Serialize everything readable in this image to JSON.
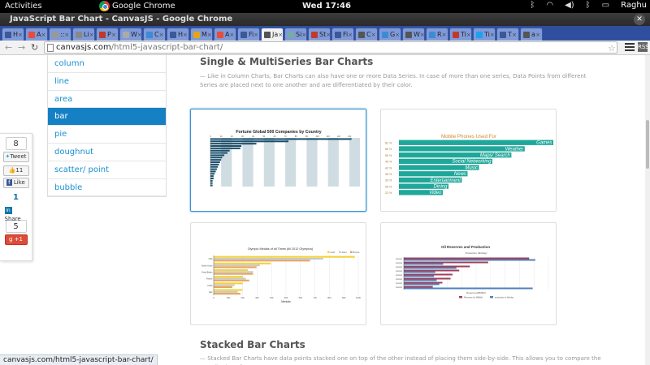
{
  "system": {
    "activities": "Activities",
    "app_name": "Google Chrome",
    "clock": "Wed 17:46",
    "user": "Raghu"
  },
  "window": {
    "title": "JavaScript Bar Chart - CanvasJS - Google Chrome"
  },
  "tabs": [
    {
      "label": "H",
      "color": "#3b5998"
    },
    {
      "label": "A",
      "color": "#e74c3c"
    },
    {
      "label": "::",
      "color": "#999"
    },
    {
      "label": "Li",
      "color": "#888"
    },
    {
      "label": "P",
      "color": "#c0392b"
    },
    {
      "label": "W",
      "color": "#aaa"
    },
    {
      "label": "C",
      "color": "#3d8bd6"
    },
    {
      "label": "H",
      "color": "#3b5998"
    },
    {
      "label": "M",
      "color": "#e8a317"
    },
    {
      "label": "A",
      "color": "#e74c3c"
    },
    {
      "label": "Fi",
      "color": "#3b5998"
    },
    {
      "label": "Ja",
      "color": "#555",
      "active": true
    },
    {
      "label": "Si",
      "color": "#7aa"
    },
    {
      "label": "St",
      "color": "#c0392b"
    },
    {
      "label": "Fi",
      "color": "#3b5998"
    },
    {
      "label": "C",
      "color": "#555"
    },
    {
      "label": "G",
      "color": "#3d8bd6"
    },
    {
      "label": "W",
      "color": "#555"
    },
    {
      "label": "R",
      "color": "#3d8bd6"
    },
    {
      "label": "Ti",
      "color": "#c0392b"
    },
    {
      "label": "Ti",
      "color": "#1da1f2"
    },
    {
      "label": "T",
      "color": "#3b5998"
    },
    {
      "label": "a",
      "color": "#555"
    }
  ],
  "address": {
    "domain": "canvasjs.com",
    "path": "/html5-javascript-bar-chart/"
  },
  "sidenav": [
    {
      "label": "column",
      "active": false
    },
    {
      "label": "line",
      "active": false
    },
    {
      "label": "area",
      "active": false
    },
    {
      "label": "bar",
      "active": true
    },
    {
      "label": "pie",
      "active": false
    },
    {
      "label": "doughnut",
      "active": false
    },
    {
      "label": "scatter/ point",
      "active": false
    },
    {
      "label": "bubble",
      "active": false
    }
  ],
  "social": {
    "tweet_count": "8",
    "tweet_label": "Tweet",
    "like_count": "11",
    "fb_like_label": "Like",
    "linkedin_count": "1",
    "share_label": "Share",
    "gplus_count": "5",
    "gplus_label": "+1"
  },
  "section1": {
    "title": "Single & MultiSeries Bar Charts",
    "desc": "— Like in Column Charts, Bar Charts can also have one or more Data Series. In case of more than one series, Data Points from different Series are placed next to one another and are differentiated by their color."
  },
  "section2": {
    "title": "Stacked Bar Charts",
    "desc": "— Stacked Bar Charts have data points stacked one on top of the other instead of placing them side-by-side. This allows you to compare the contribution of"
  },
  "thumbnails": {
    "fortune": {
      "title": "Fortune Global 500 Companies by Country",
      "ticks": [
        "0",
        "10",
        "20",
        "30",
        "40",
        "50",
        "60",
        "70",
        "80",
        "90",
        "100",
        "110",
        "120",
        "130"
      ],
      "values": [
        132,
        73,
        43,
        29,
        28,
        18,
        16,
        13,
        11,
        10,
        9,
        8,
        7,
        6,
        5,
        4,
        3,
        3,
        2,
        2,
        2
      ]
    },
    "mobile": {
      "title": "Mobile Phones Used For",
      "rows": [
        {
          "label": "Games",
          "pct": "81 %",
          "value": 81
        },
        {
          "label": "Weather",
          "pct": "66 %",
          "value": 66
        },
        {
          "label": "Maps/ Search",
          "pct": "59 %",
          "value": 59
        },
        {
          "label": "Social Networking",
          "pct": "49 %",
          "value": 49
        },
        {
          "label": "Music",
          "pct": "42 %",
          "value": 42
        },
        {
          "label": "News",
          "pct": "36 %",
          "value": 36
        },
        {
          "label": "Entertainment",
          "pct": "33 %",
          "value": 33
        },
        {
          "label": "Dining",
          "pct": "26 %",
          "value": 26
        },
        {
          "label": "Video",
          "pct": "23 %",
          "value": 23
        }
      ],
      "colors": {
        "bar": "#1fa79a",
        "title": "#d58a2c"
      }
    },
    "olympic": {
      "title": "Olympic Medals of all Times (till 2012 Olympics)",
      "legend": [
        "Gold",
        "Silver",
        "Bronze"
      ],
      "countries": [
        "USA",
        "Soviet Union",
        "Great Britain",
        "France",
        "China",
        "Italy"
      ],
      "gold": [
        976,
        395,
        236,
        202,
        201,
        198
      ],
      "silver": [
        757,
        319,
        272,
        223,
        144,
        166
      ],
      "bronze": [
        666,
        296,
        272,
        246,
        128,
        185
      ],
      "ticks": [
        "0",
        "100",
        "200",
        "300",
        "400",
        "500",
        "600",
        "700",
        "800",
        "900",
        "1000"
      ],
      "xlabel": "Medals",
      "colors": {
        "gold": "#f2d33b",
        "silver": "#c9c9c9",
        "bronze": "#e8a45c"
      }
    },
    "oil": {
      "title": "Oil Reserves and Production",
      "axis2_label": "Production (bbl/day)",
      "xlabel": "Reserves(MMbbl)",
      "legend": [
        "Reserves (in MMbbl)",
        "production in bbl/day"
      ],
      "reserves": [
        260,
        175,
        137,
        115,
        101,
        97,
        80,
        60
      ],
      "production": [
        10,
        3,
        4,
        2.4,
        2.3,
        2.5,
        2.7,
        9.8
      ],
      "colors": {
        "reserves": "#a0405a",
        "production": "#4f81bd"
      }
    }
  },
  "status_url": "canvasjs.com/html5-javascript-bar-chart/"
}
